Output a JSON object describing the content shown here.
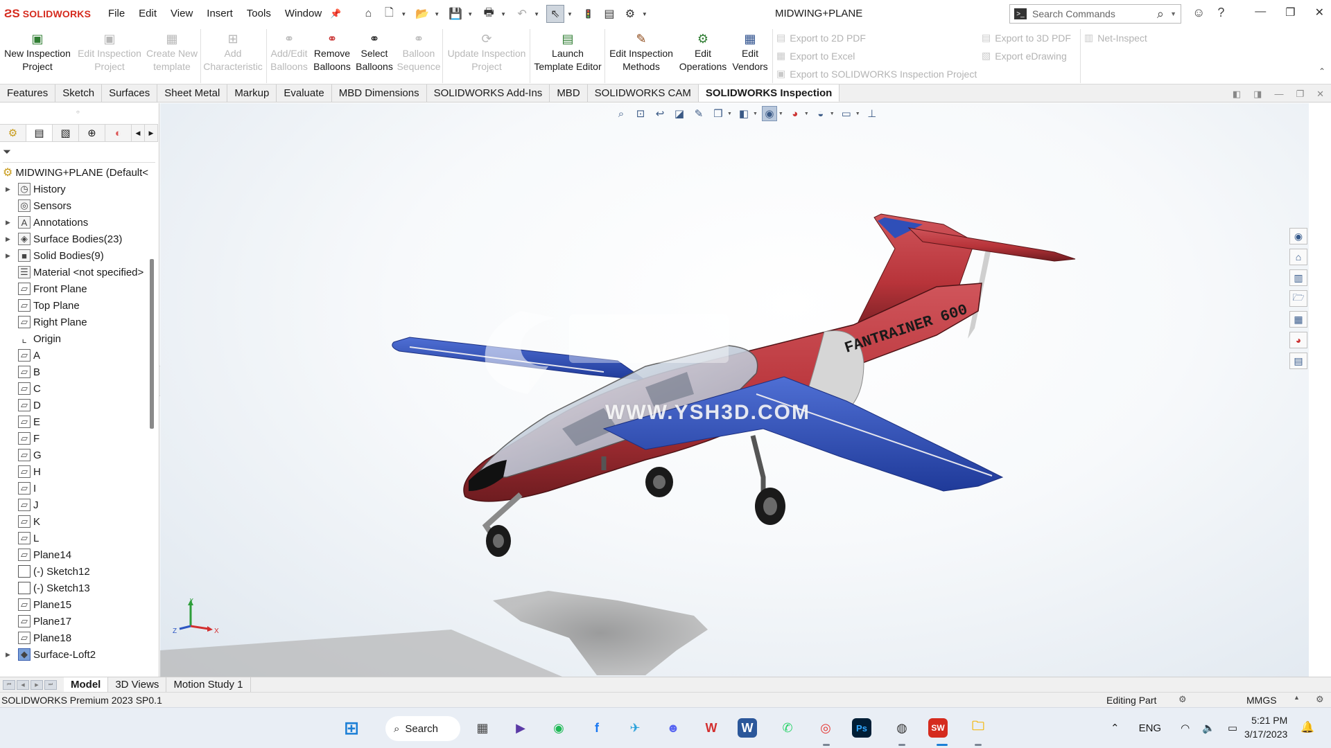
{
  "app": {
    "logo_text": "SOLIDWORKS",
    "menu": [
      "File",
      "Edit",
      "View",
      "Insert",
      "Tools",
      "Window"
    ],
    "document_title": "MIDWING+PLANE",
    "search_placeholder": "Search Commands"
  },
  "ribbon": {
    "buttons": [
      {
        "label": "New Inspection Project",
        "enabled": true
      },
      {
        "label": "Edit Inspection Project",
        "enabled": false
      },
      {
        "label": "Create New template",
        "enabled": false
      },
      {
        "label": "Add Characteristic",
        "enabled": false
      },
      {
        "label": "Add/Edit Balloons",
        "enabled": false
      },
      {
        "label": "Remove Balloons",
        "enabled": true
      },
      {
        "label": "Select Balloons",
        "enabled": true
      },
      {
        "label": "Balloon Sequence",
        "enabled": false
      },
      {
        "label": "Update Inspection Project",
        "enabled": false
      },
      {
        "label": "Launch Template Editor",
        "enabled": true
      },
      {
        "label": "Edit Inspection Methods",
        "enabled": true
      },
      {
        "label": "Edit Operations",
        "enabled": true
      },
      {
        "label": "Edit Vendors",
        "enabled": true
      }
    ],
    "exports": [
      "Export to 2D PDF",
      "Export to Excel",
      "Export to SOLIDWORKS Inspection Project",
      "Export to 3D PDF",
      "Export eDrawing",
      "Net-Inspect"
    ]
  },
  "command_tabs": [
    "Features",
    "Sketch",
    "Surfaces",
    "Sheet Metal",
    "Markup",
    "Evaluate",
    "MBD Dimensions",
    "SOLIDWORKS Add-Ins",
    "MBD",
    "SOLIDWORKS CAM",
    "SOLIDWORKS Inspection"
  ],
  "active_command_tab": "SOLIDWORKS Inspection",
  "tree": {
    "root": "MIDWING+PLANE  (Default<",
    "items": [
      {
        "label": "History",
        "icon": "history-icon",
        "expandable": true
      },
      {
        "label": "Sensors",
        "icon": "sensors-icon",
        "expandable": false
      },
      {
        "label": "Annotations",
        "icon": "annotations-icon",
        "expandable": true
      },
      {
        "label": "Surface Bodies(23)",
        "icon": "surface-bodies-icon",
        "expandable": true
      },
      {
        "label": "Solid Bodies(9)",
        "icon": "solid-bodies-icon",
        "expandable": true
      },
      {
        "label": "Material <not specified>",
        "icon": "material-icon",
        "expandable": false
      },
      {
        "label": "Front Plane",
        "icon": "plane-icon",
        "expandable": false
      },
      {
        "label": "Top Plane",
        "icon": "plane-icon",
        "expandable": false
      },
      {
        "label": "Right Plane",
        "icon": "plane-icon",
        "expandable": false
      },
      {
        "label": "Origin",
        "icon": "origin-icon",
        "expandable": false
      },
      {
        "label": "A",
        "icon": "plane-icon",
        "expandable": false
      },
      {
        "label": "B",
        "icon": "plane-icon",
        "expandable": false
      },
      {
        "label": "C",
        "icon": "plane-icon",
        "expandable": false
      },
      {
        "label": "D",
        "icon": "plane-icon",
        "expandable": false
      },
      {
        "label": "E",
        "icon": "plane-icon",
        "expandable": false
      },
      {
        "label": "F",
        "icon": "plane-icon",
        "expandable": false
      },
      {
        "label": "G",
        "icon": "plane-icon",
        "expandable": false
      },
      {
        "label": "H",
        "icon": "plane-icon",
        "expandable": false
      },
      {
        "label": "I",
        "icon": "plane-icon",
        "expandable": false
      },
      {
        "label": "J",
        "icon": "plane-icon",
        "expandable": false
      },
      {
        "label": "K",
        "icon": "plane-icon",
        "expandable": false
      },
      {
        "label": "L",
        "icon": "plane-icon",
        "expandable": false
      },
      {
        "label": "Plane14",
        "icon": "plane-icon",
        "expandable": false
      },
      {
        "label": "(-) Sketch12",
        "icon": "sketch-icon",
        "expandable": false
      },
      {
        "label": "(-) Sketch13",
        "icon": "sketch-icon",
        "expandable": false
      },
      {
        "label": "Plane15",
        "icon": "plane-icon",
        "expandable": false
      },
      {
        "label": "Plane17",
        "icon": "plane-icon",
        "expandable": false
      },
      {
        "label": "Plane18",
        "icon": "plane-icon",
        "expandable": false
      },
      {
        "label": "Surface-Loft2",
        "icon": "surface-loft-icon",
        "expandable": true
      }
    ]
  },
  "viewport": {
    "fuselage_text": "FANTRAINER 600",
    "watermark_url": "WWW.YSH3D.COM",
    "triad": {
      "x": "X",
      "y": "Y",
      "z": "Z"
    },
    "colors": {
      "fuselage": "#b8343a",
      "wing": "#2f4fb8",
      "background_edge": "#dfe7ef"
    }
  },
  "bottom_tabs": [
    "Model",
    "3D Views",
    "Motion Study 1"
  ],
  "active_bottom_tab": "Model",
  "status": {
    "product": "SOLIDWORKS Premium 2023 SP0.1",
    "mode": "Editing Part",
    "units": "MMGS"
  },
  "taskbar": {
    "search_label": "Search",
    "language": "ENG",
    "time": "5:21 PM",
    "date": "3/17/2023"
  }
}
